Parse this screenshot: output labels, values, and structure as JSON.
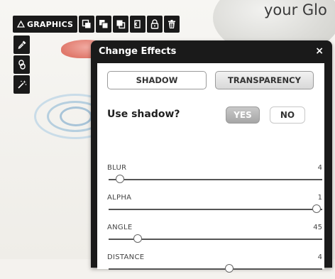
{
  "background": {
    "heading_text": "your Glo"
  },
  "toolbar": {
    "graphics_label": "GRAPHICS",
    "graphics_icon": "triangle-icon",
    "tools": [
      {
        "name": "bring-forward-icon"
      },
      {
        "name": "bring-to-front-icon"
      },
      {
        "name": "send-backward-icon"
      },
      {
        "name": "send-to-back-icon"
      },
      {
        "name": "lock-icon"
      },
      {
        "name": "trash-icon"
      }
    ]
  },
  "left_tools": [
    {
      "name": "eyedropper-icon"
    },
    {
      "name": "link-icon"
    },
    {
      "name": "magic-wand-icon"
    }
  ],
  "dialog": {
    "title": "Change Effects",
    "close": "×",
    "tabs": {
      "shadow": "SHADOW",
      "transparency": "TRANSPARENCY",
      "active": "shadow"
    },
    "use_shadow": {
      "label": "Use shadow?",
      "yes": "YES",
      "no": "NO",
      "selected": "YES"
    },
    "sliders": {
      "blur": {
        "label": "BLUR",
        "value": "4",
        "level": 0.0
      },
      "alpha": {
        "label": "ALPHA",
        "value": "1",
        "level": 1.0
      },
      "angle": {
        "label": "ANGLE",
        "value": "45",
        "level": 0.08
      },
      "distance": {
        "label": "DISTANCE",
        "value": "4",
        "level": 0.55
      }
    }
  },
  "colors": {
    "toolbar_bg": "#1a1a1a",
    "dialog_header": "#1a1a1a",
    "dialog_body": "#ffffff",
    "selected_toggle": "#b3b3b3"
  }
}
